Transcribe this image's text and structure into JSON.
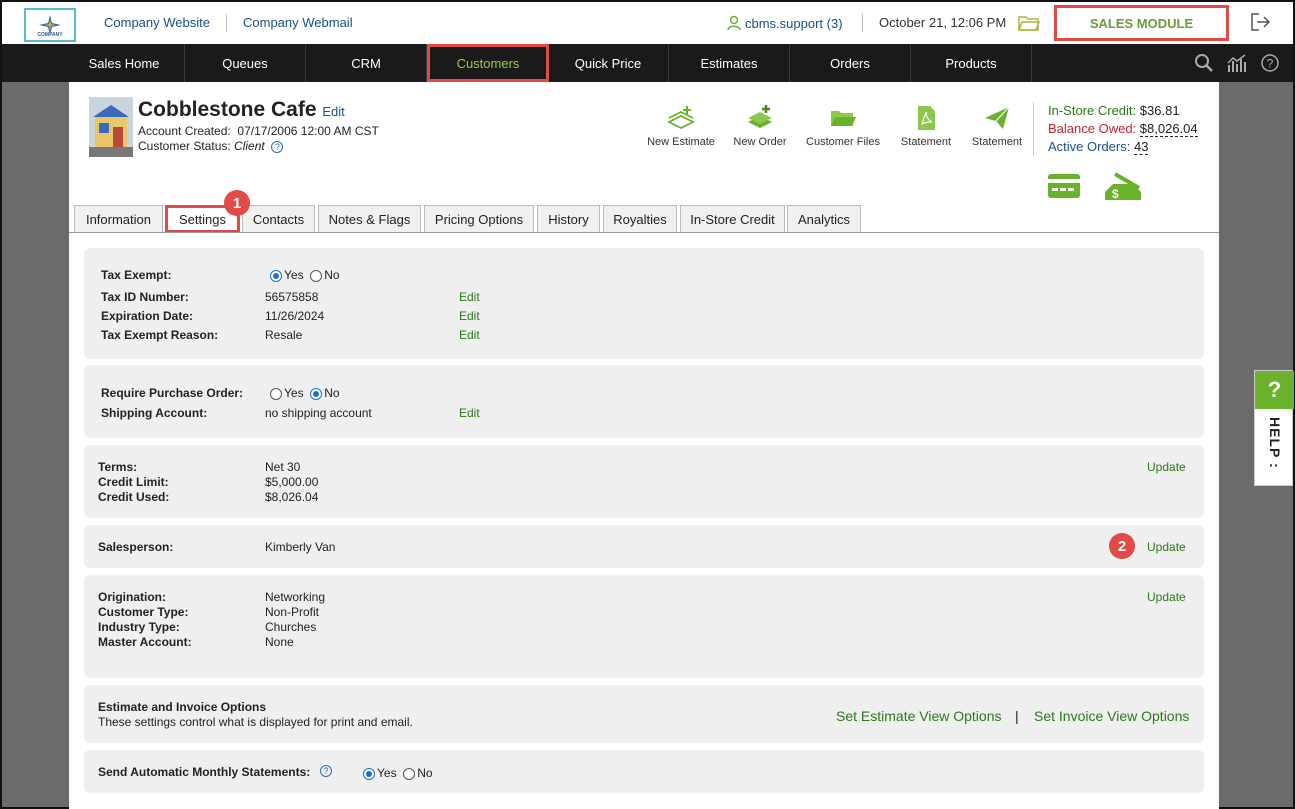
{
  "header": {
    "logo_text": "COMPANY",
    "company_website": "Company Website",
    "company_webmail": "Company Webmail",
    "user": "cbms.support (3)",
    "datetime": "October 21, 12:06 PM",
    "sales_module": "SALES MODULE"
  },
  "nav": {
    "items": [
      "Sales Home",
      "Queues",
      "CRM",
      "Customers",
      "Quick Price",
      "Estimates",
      "Orders",
      "Products"
    ],
    "active": "Customers"
  },
  "customer": {
    "name": "Cobblestone Cafe",
    "edit": "Edit",
    "account_created_label": "Account Created:",
    "account_created": "07/17/2006 12:00 AM CST",
    "status_label": "Customer Status:",
    "status": "Client"
  },
  "actions": [
    "New Estimate",
    "New Order",
    "Customer Files",
    "Statement",
    "Statement"
  ],
  "balances": {
    "in_store_credit_label": "In-Store Credit:",
    "in_store_credit": "$36.81",
    "balance_owed_label": "Balance Owed:",
    "balance_owed": "$8,026.04",
    "active_orders_label": "Active Orders:",
    "active_orders": "43"
  },
  "tabs": [
    "Information",
    "Settings",
    "Contacts",
    "Notes & Flags",
    "Pricing Options",
    "History",
    "Royalties",
    "In-Store Credit",
    "Analytics"
  ],
  "active_tab": "Settings",
  "badges": [
    "1",
    "2"
  ],
  "tax": {
    "exempt_label": "Tax Exempt:",
    "yes": "Yes",
    "no": "No",
    "tax_id_label": "Tax ID Number:",
    "tax_id": "56575858",
    "expiration_label": "Expiration Date:",
    "expiration": "11/26/2024",
    "reason_label": "Tax Exempt Reason:",
    "reason": "Resale",
    "edit": "Edit"
  },
  "purchase": {
    "require_po_label": "Require Purchase Order:",
    "yes": "Yes",
    "no": "No",
    "shipping_label": "Shipping Account:",
    "shipping": "no shipping account",
    "edit": "Edit"
  },
  "terms": {
    "terms_label": "Terms:",
    "terms": "Net 30",
    "credit_limit_label": "Credit Limit:",
    "credit_limit": "$5,000.00",
    "credit_used_label": "Credit Used:",
    "credit_used": "$8,026.04",
    "update": "Update"
  },
  "salesperson": {
    "label": "Salesperson:",
    "value": "Kimberly Van",
    "update": "Update"
  },
  "origination": {
    "origination_label": "Origination:",
    "origination": "Networking",
    "customer_type_label": "Customer Type:",
    "customer_type": "Non-Profit",
    "industry_label": "Industry Type:",
    "industry": "Churches",
    "master_label": "Master Account:",
    "master": "None",
    "update": "Update"
  },
  "estimate_options": {
    "title": "Estimate and Invoice Options",
    "desc": "These settings control what is displayed for print and email.",
    "estimate_link": "Set Estimate View Options",
    "sep": "|",
    "invoice_link": "Set Invoice View Options"
  },
  "statements": {
    "label": "Send Automatic Monthly Statements:",
    "yes": "Yes",
    "no": "No"
  },
  "help": {
    "q": "?",
    "label": "HELP :"
  },
  "colors": {
    "accent_green": "#6ab22c",
    "highlight_red": "#e24a46",
    "link_blue": "#1a4e8a"
  }
}
